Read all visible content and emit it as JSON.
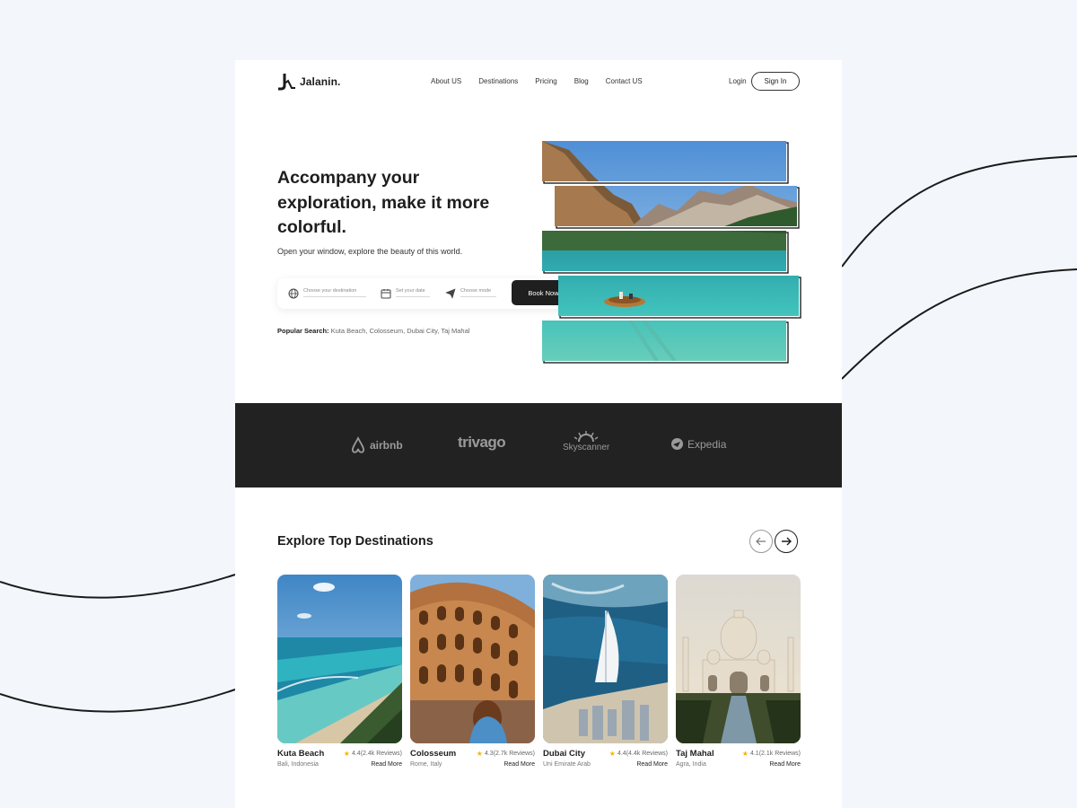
{
  "brand": {
    "name": "Jalanin."
  },
  "nav": {
    "links": [
      "About US",
      "Destinations",
      "Pricing",
      "Blog",
      "Contact US"
    ],
    "login": "Login",
    "signin": "Sign In"
  },
  "hero": {
    "title": "Accompany your exploration, make it more colorful.",
    "subtitle": "Open your window, explore the beauty of this world.",
    "search": {
      "destination_placeholder": "Choose your destination",
      "date_placeholder": "Set your date",
      "mode_placeholder": "Choose mode",
      "button": "Book Now"
    },
    "popular_label": "Popular Search:",
    "popular_items": "Kuta Beach, Colosseum, Dubai City, Taj Mahal"
  },
  "partners": {
    "airbnb": "airbnb",
    "trivago": "trivago",
    "skyscanner": "Skyscanner",
    "expedia": "Expedia"
  },
  "explore": {
    "title": "Explore Top Destinations",
    "read_more": "Read More",
    "destinations": [
      {
        "name": "Kuta Beach",
        "rating": "4.4(2.4k Reviews)",
        "location": "Bali, Indonesia"
      },
      {
        "name": "Colosseum",
        "rating": "4.3(2.7k Reviews)",
        "location": "Rome, Italy"
      },
      {
        "name": "Dubai City",
        "rating": "4.4(4.4k Reviews)",
        "location": "Uni Emirate Arab"
      },
      {
        "name": "Taj Mahal",
        "rating": "4.1(2.1k Reviews)",
        "location": "Agra, India"
      }
    ]
  },
  "colors": {
    "page_bg": "#f3f7fc",
    "dark": "#222222",
    "star": "#f2b600",
    "water": "#2fb1b0"
  },
  "icons": [
    "globe-icon",
    "calendar-icon",
    "plane-icon",
    "arrow-left-icon",
    "arrow-right-icon",
    "star-icon"
  ]
}
